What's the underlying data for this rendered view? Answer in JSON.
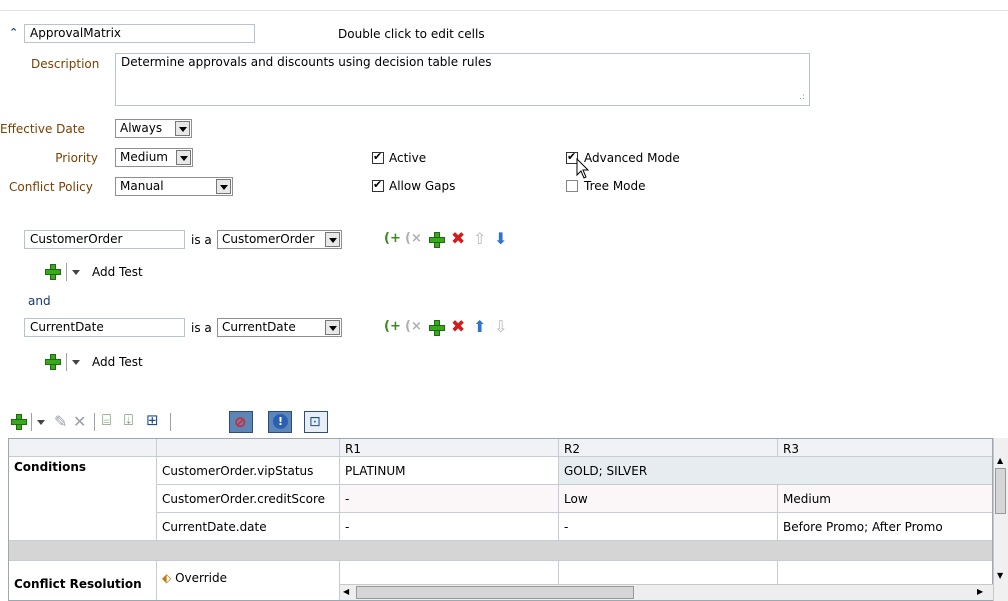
{
  "ruleset": {
    "name": "ApprovalMatrix",
    "hint": "Double click to edit cells",
    "description_label": "Description",
    "description": "Determine approvals and discounts using decision table rules",
    "effective_date_label": "Effective Date",
    "effective_date": "Always",
    "priority_label": "Priority",
    "priority": "Medium",
    "conflict_policy_label": "Conflict Policy",
    "conflict_policy": "Manual",
    "active_label": "Active",
    "active_checked": true,
    "allow_gaps_label": "Allow Gaps",
    "allow_gaps_checked": true,
    "advanced_mode_label": "Advanced Mode",
    "advanced_mode_checked": true,
    "tree_mode_label": "Tree Mode",
    "tree_mode_checked": false
  },
  "patterns": [
    {
      "variable": "CustomerOrder",
      "is_a": "is a",
      "type": "CustomerOrder",
      "add_test": "Add Test"
    },
    {
      "variable": "CurrentDate",
      "is_a": "is a",
      "type": "CurrentDate",
      "add_test": "Add Test"
    }
  ],
  "and_label": "and",
  "table": {
    "columns": [
      "R1",
      "R2",
      "R3"
    ],
    "sections": {
      "conditions": "Conditions",
      "conflict_resolution": "Conflict Resolution"
    },
    "rows": [
      {
        "name": "CustomerOrder.vipStatus",
        "r1": "PLATINUM",
        "r2": "GOLD; SILVER",
        "r3": ""
      },
      {
        "name": "CustomerOrder.creditScore",
        "r1": "-",
        "r2": "Low",
        "r3": "Medium"
      },
      {
        "name": "CurrentDate.date",
        "r1": "-",
        "r2": "-",
        "r3": "Before Promo; After Promo"
      }
    ],
    "override_label": "Override"
  },
  "colors": {
    "label_brown": "#7a3e00",
    "add_green": "#3aa81f",
    "delete_red": "#d01c1c",
    "arrow_blue": "#2e72d2"
  }
}
